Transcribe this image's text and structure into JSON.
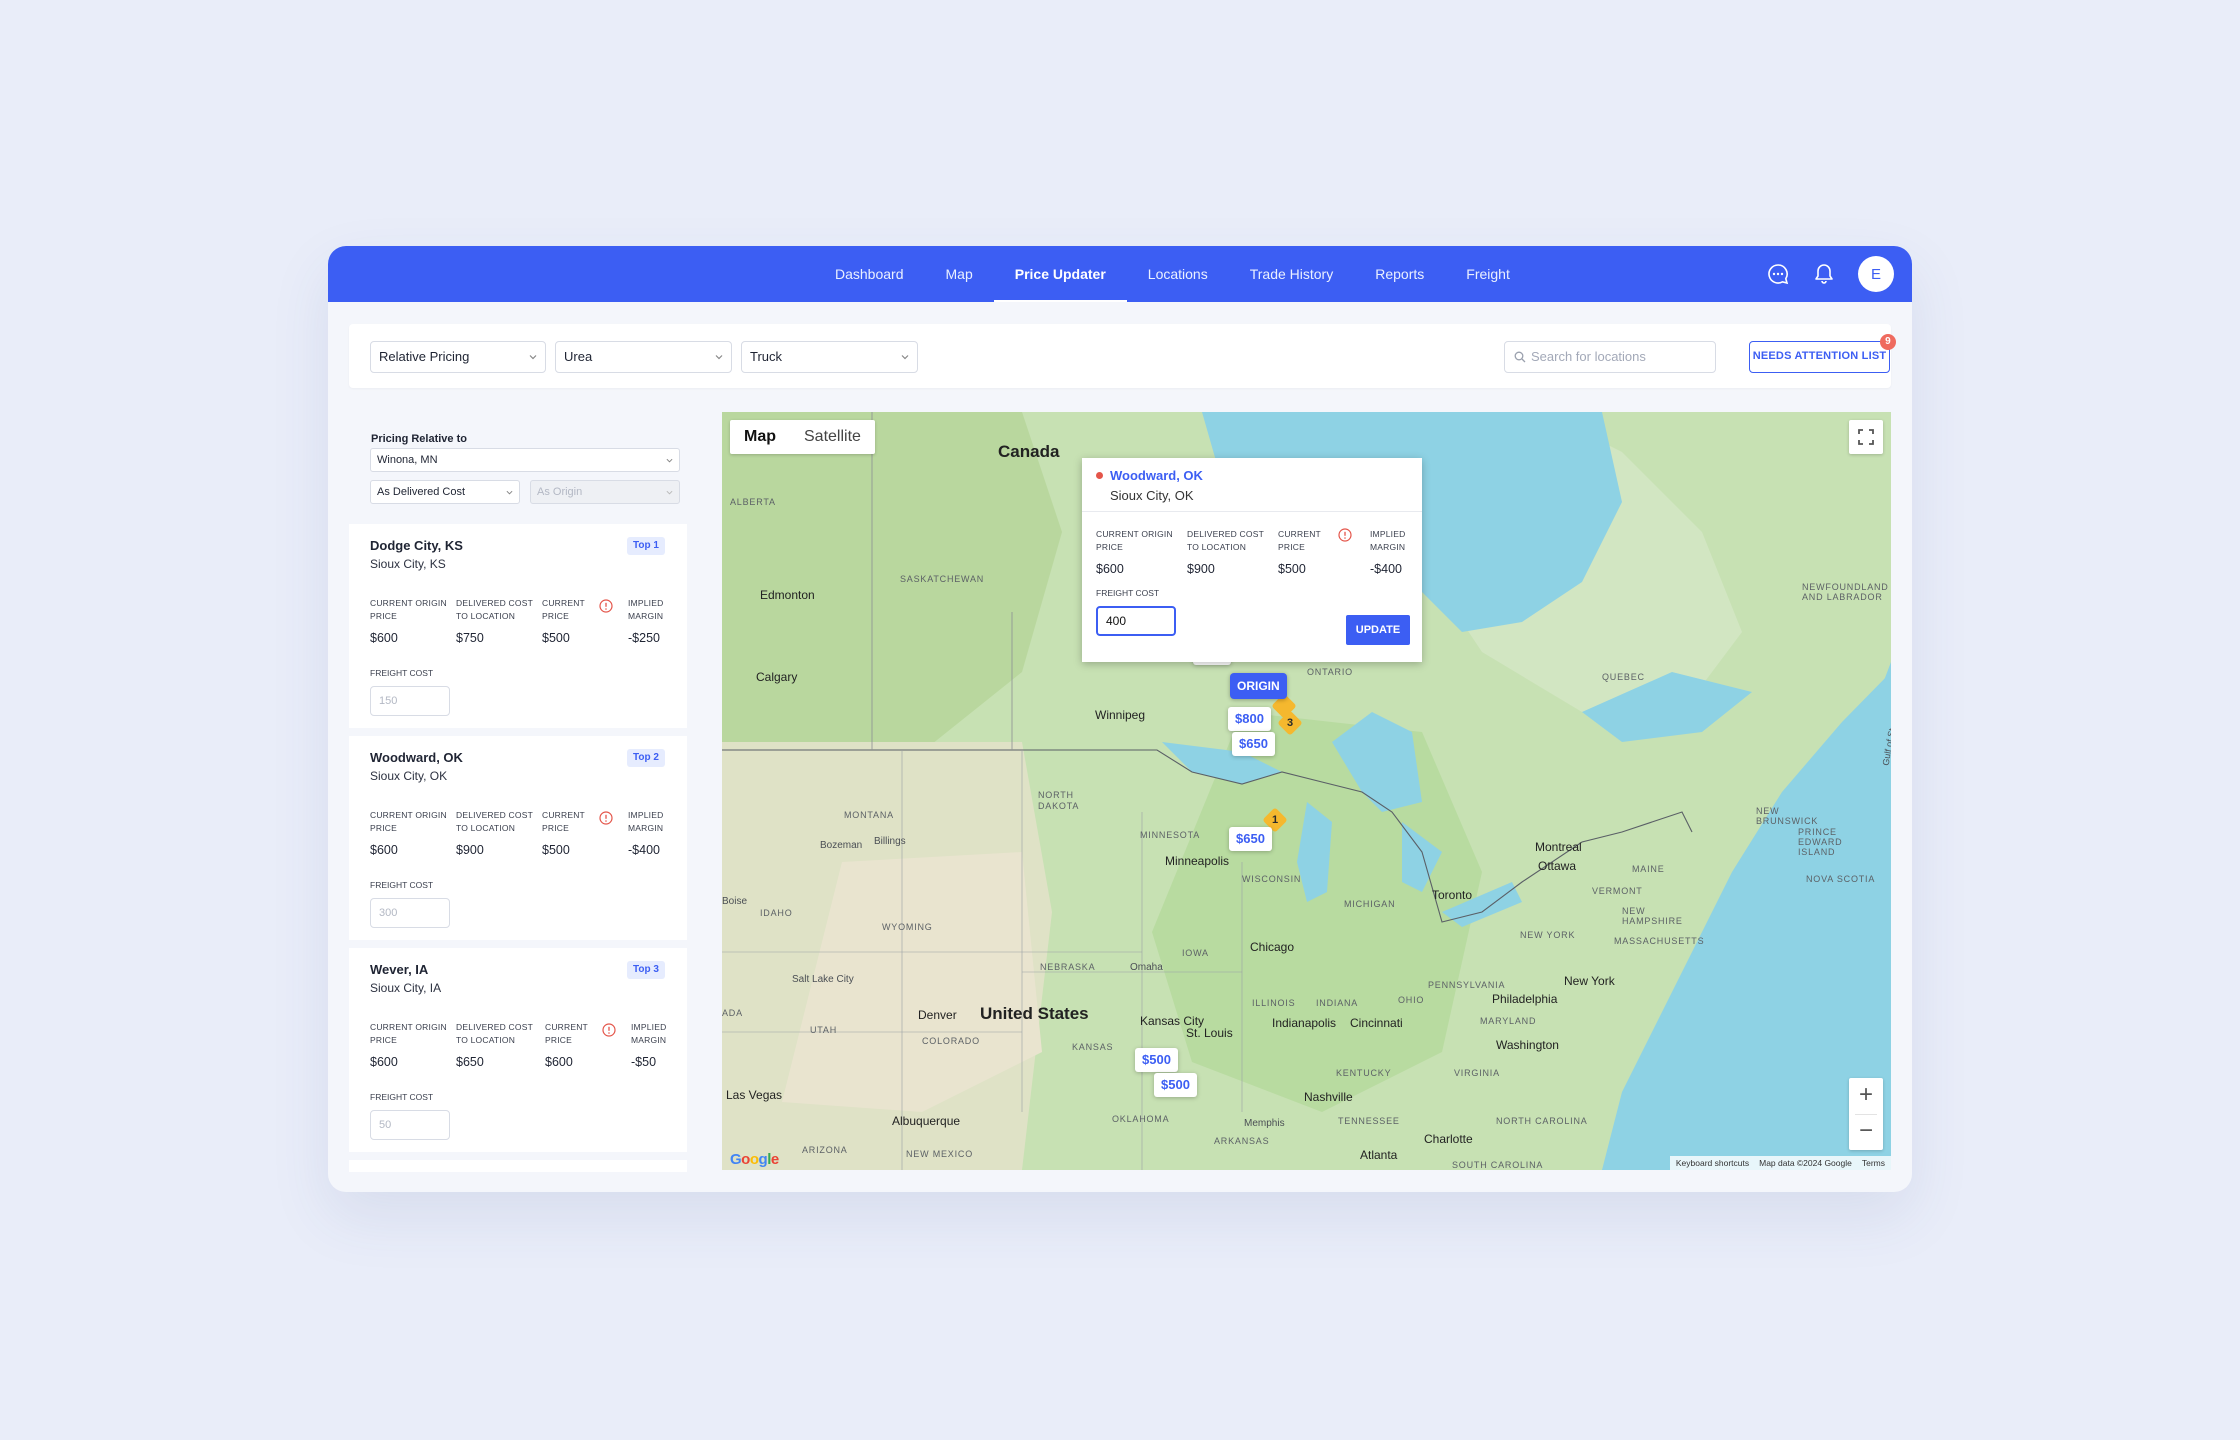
{
  "nav": {
    "items": [
      {
        "label": "Dashboard"
      },
      {
        "label": "Map"
      },
      {
        "label": "Price Updater"
      },
      {
        "label": "Locations"
      },
      {
        "label": "Trade History"
      },
      {
        "label": "Reports"
      },
      {
        "label": "Freight"
      }
    ],
    "active": "Price Updater",
    "avatar_initial": "E",
    "icons": [
      "chat-icon",
      "bell-icon"
    ]
  },
  "filters": {
    "pricing_mode": "Relative Pricing",
    "product": "Urea",
    "transport": "Truck",
    "search_placeholder": "Search for locations",
    "attention_label": "NEEDS ATTENTION LIST",
    "attention_count": "9"
  },
  "relative": {
    "label": "Pricing Relative to",
    "location": "Winona, MN",
    "cost_basis": "As Delivered Cost",
    "origin_basis": "As Origin"
  },
  "columns": {
    "origin_price": "CURRENT ORIGIN PRICE",
    "delivered_cost": "DELIVERED COST TO LOCATION",
    "current_price": "CURRENT PRICE",
    "implied_margin": "IMPLIED MARGIN",
    "freight_cost": "FREIGHT COST"
  },
  "cards": [
    {
      "name": "Dodge City, KS",
      "sub": "Sioux City, KS",
      "badge": "Top 1",
      "origin_price": "$600",
      "delivered_cost": "$750",
      "current_price": "$500",
      "implied_margin": "-$250",
      "freight_placeholder": "150"
    },
    {
      "name": "Woodward, OK",
      "sub": "Sioux City, OK",
      "badge": "Top 2",
      "origin_price": "$600",
      "delivered_cost": "$900",
      "current_price": "$500",
      "implied_margin": "-$400",
      "freight_placeholder": "300"
    },
    {
      "name": "Wever, IA",
      "sub": "Sioux City, IA",
      "badge": "Top 3",
      "origin_price": "$600",
      "delivered_cost": "$650",
      "current_price": "$600",
      "implied_margin": "-$50",
      "freight_placeholder": "50"
    }
  ],
  "map": {
    "toggle": [
      "Map",
      "Satellite"
    ],
    "active_toggle": "Map",
    "zoom_in": "+",
    "zoom_out": "−",
    "attribution": [
      "Keyboard shortcuts",
      "Map data ©2024 Google",
      "Terms"
    ],
    "logo": "Google",
    "countries": [
      "Canada",
      "United States"
    ],
    "regions": [
      "ALBERTA",
      "SASKATCHEWAN",
      "ONTARIO",
      "QUEBEC",
      "NEWFOUNDLAND AND LABRADOR",
      "NORTH DAKOTA",
      "MONTANA",
      "MINNESOTA",
      "WISCONSIN",
      "MICHIGAN",
      "IOWA",
      "NEBRASKA",
      "ILLINOIS",
      "INDIANA",
      "OHIO",
      "KANSAS",
      "COLORADO",
      "UTAH",
      "IDAHO",
      "WYOMING",
      "NEW BRUNSWICK",
      "PRINCE EDWARD ISLAND",
      "NOVA SCOTIA",
      "MAINE",
      "VERMONT",
      "NEW HAMPSHIRE",
      "MASSACHUSETTS",
      "NEW YORK",
      "PENNSYLVANIA",
      "MARYLAND",
      "VIRGINIA",
      "KENTUCKY",
      "TENNESSEE",
      "NORTH CAROLINA",
      "SOUTH CAROLINA",
      "OKLAHOMA",
      "ARKANSAS",
      "ARIZONA",
      "NEW MEXICO",
      "ADA"
    ],
    "cities": [
      "Edmonton",
      "Calgary",
      "Winnipeg",
      "Minneapolis",
      "Chicago",
      "Toronto",
      "Montreal",
      "Ottawa",
      "New York",
      "Philadelphia",
      "Washington",
      "Kansas City",
      "St. Louis",
      "Indianapolis",
      "Cincinnati",
      "Nashville",
      "Charlotte",
      "Atlanta",
      "Albuquerque",
      "Las Vegas",
      "Denver",
      "Omaha",
      "Salt Lake City",
      "Boise",
      "Billings",
      "Bozeman",
      "Memphis",
      "Gulf of St"
    ],
    "pins": [
      "$800",
      "$650",
      "$650",
      "$500",
      "$500",
      "$500"
    ],
    "origin_label": "ORIGIN",
    "clusters": [
      "3",
      "1"
    ]
  },
  "popup": {
    "name": "Woodward, OK",
    "sub": "Sioux City, OK",
    "origin_price": "$600",
    "delivered_cost": "$900",
    "current_price": "$500",
    "implied_margin": "-$400",
    "freight_value": "400",
    "update_label": "UPDATE"
  },
  "colors": {
    "brand": "#3c5ef3",
    "warning": "#e4554a",
    "cluster": "#f5b82e"
  }
}
